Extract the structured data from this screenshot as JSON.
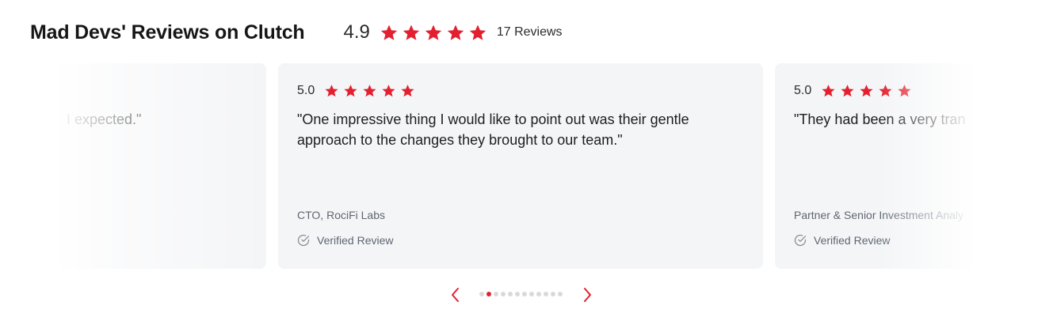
{
  "header": {
    "title": "Mad Devs' Reviews on Clutch",
    "rating": "4.9",
    "stars": 5,
    "reviews_count": "17 Reviews"
  },
  "colors": {
    "accent": "#e3202f",
    "card_bg": "#f4f5f7",
    "muted_text": "#5f6670",
    "dot_inactive": "#d9d9d9"
  },
  "cards": [
    {
      "score": "",
      "quote": "I expected.\"",
      "author": "",
      "verified_label": ""
    },
    {
      "score": "5.0",
      "stars": 5,
      "quote": "\"One impressive thing I would like to point out was their gentle approach to the changes they brought to our team.\"",
      "author": "CTO, RociFi Labs",
      "verified_label": "Verified Review",
      "verified_icon": "check-circle-icon"
    },
    {
      "score": "5.0",
      "stars": 5,
      "quote": "\"They had been a very tran",
      "author": "Partner & Senior Investment Analy",
      "verified_label": "Verified Review",
      "verified_icon": "check-circle-icon"
    }
  ],
  "pagination": {
    "prev_icon": "chevron-left-icon",
    "next_icon": "chevron-right-icon",
    "total_dots": 12,
    "active_index": 1
  }
}
